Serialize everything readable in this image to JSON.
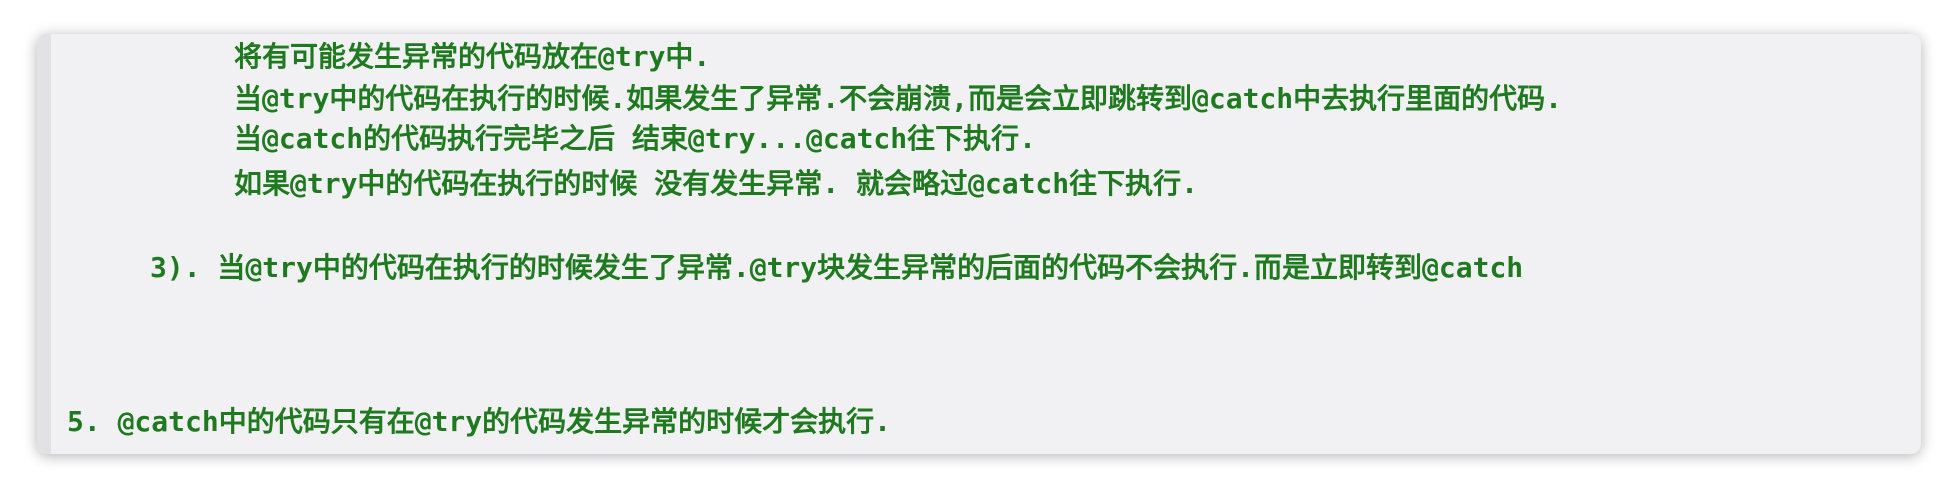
{
  "lines": [
    "将有可能发生异常的代码放在@try中.",
    "当@try中的代码在执行的时候.如果发生了异常.不会崩溃,而是会立即跳转到@catch中去执行里面的代码.",
    "当@catch的代码执行完毕之后 结束@try...@catch往下执行.",
    "如果@try中的代码在执行的时候 没有发生异常. 就会略过@catch往下执行.",
    "3). 当@try中的代码在执行的时候发生了异常.@try块发生异常的后面的代码不会执行.而是立即转到@catch",
    "5. @catch中的代码只有在@try的代码发生异常的时候才会执行."
  ],
  "colors": {
    "text": "#1f7a1f",
    "background": "#f1f0f3"
  }
}
